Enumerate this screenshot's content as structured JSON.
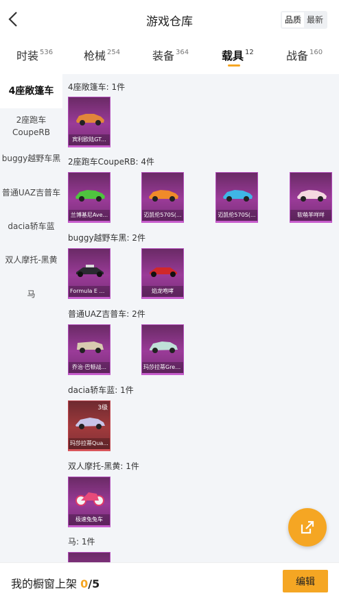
{
  "header": {
    "title": "游戏仓库",
    "sort_options": [
      "品质",
      "最新"
    ]
  },
  "tabs": [
    {
      "label": "时装",
      "count": "536"
    },
    {
      "label": "枪械",
      "count": "254"
    },
    {
      "label": "装备",
      "count": "364"
    },
    {
      "label": "载具",
      "count": "12"
    },
    {
      "label": "战备",
      "count": "160"
    }
  ],
  "sidebar": {
    "items": [
      {
        "label": "4座敞篷车"
      },
      {
        "label": "2座跑车\nCoupeRB"
      },
      {
        "label": "buggy越野车黑"
      },
      {
        "label": "普通UAZ吉普车"
      },
      {
        "label": "dacia轿车蓝"
      },
      {
        "label": "双人摩托-黑黄"
      },
      {
        "label": "马"
      }
    ]
  },
  "sections": [
    {
      "title": "4座敞篷车: 1件",
      "items": [
        {
          "name": "宾利欧陆GT..."
        }
      ]
    },
    {
      "title": "2座跑车CoupeRB: 4件",
      "items": [
        {
          "name": "兰博基尼Ave..."
        },
        {
          "name": "迈凯伦570S(..."
        },
        {
          "name": "迈凯伦570S(..."
        },
        {
          "name": "软萌羊咩咩"
        }
      ]
    },
    {
      "title": "buggy越野车黑: 2件",
      "items": [
        {
          "name": "Formula E Ge..."
        },
        {
          "name": "焰龙咆哮"
        }
      ]
    },
    {
      "title": "普通UAZ吉普车: 2件",
      "items": [
        {
          "name": "乔治·巴顿战..."
        },
        {
          "name": "玛莎拉蒂Grec..."
        }
      ]
    },
    {
      "title": "dacia轿车蓝: 1件",
      "items": [
        {
          "name": "玛莎拉蒂Qua...",
          "level": "3级"
        }
      ]
    },
    {
      "title": "双人摩托-黑黄: 1件",
      "items": [
        {
          "name": "极速兔兔车"
        }
      ]
    },
    {
      "title": "马: 1件",
      "items": []
    }
  ],
  "bottom": {
    "label": "我的橱窗上架",
    "count": "0",
    "total": "/5",
    "edit_label": "编辑"
  },
  "colors": {
    "accent": "#f5a623",
    "epic_card": "#9a3b98",
    "legendary_card": "#a03a3c"
  }
}
